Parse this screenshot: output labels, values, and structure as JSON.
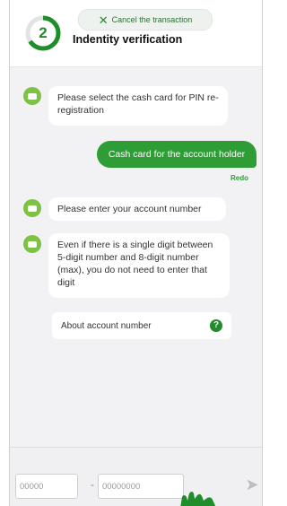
{
  "header": {
    "step_number": "2",
    "step_progress": 0.66,
    "cancel_label": "Cancel the transaction",
    "title": "Indentity verification"
  },
  "messages": [
    {
      "from": "bot",
      "text": "Please select the cash card for PIN re-registration"
    },
    {
      "from": "user",
      "text": "Cash card for the account holder"
    },
    {
      "from": "bot",
      "text": "Please enter your account number"
    },
    {
      "from": "bot",
      "text": "Even if there is a single digit between 5-digit number and 8-digit number (max), you do not need to enter that digit"
    }
  ],
  "redo_label": "Redo",
  "account_link": {
    "label": "About account number",
    "icon": "info-icon"
  },
  "input": {
    "branch_placeholder": "00000",
    "separator": "-",
    "account_placeholder": "00000000"
  },
  "colors": {
    "accent": "#2e9d36",
    "bot_icon": "#7cc243",
    "background": "#f2f2f4"
  }
}
